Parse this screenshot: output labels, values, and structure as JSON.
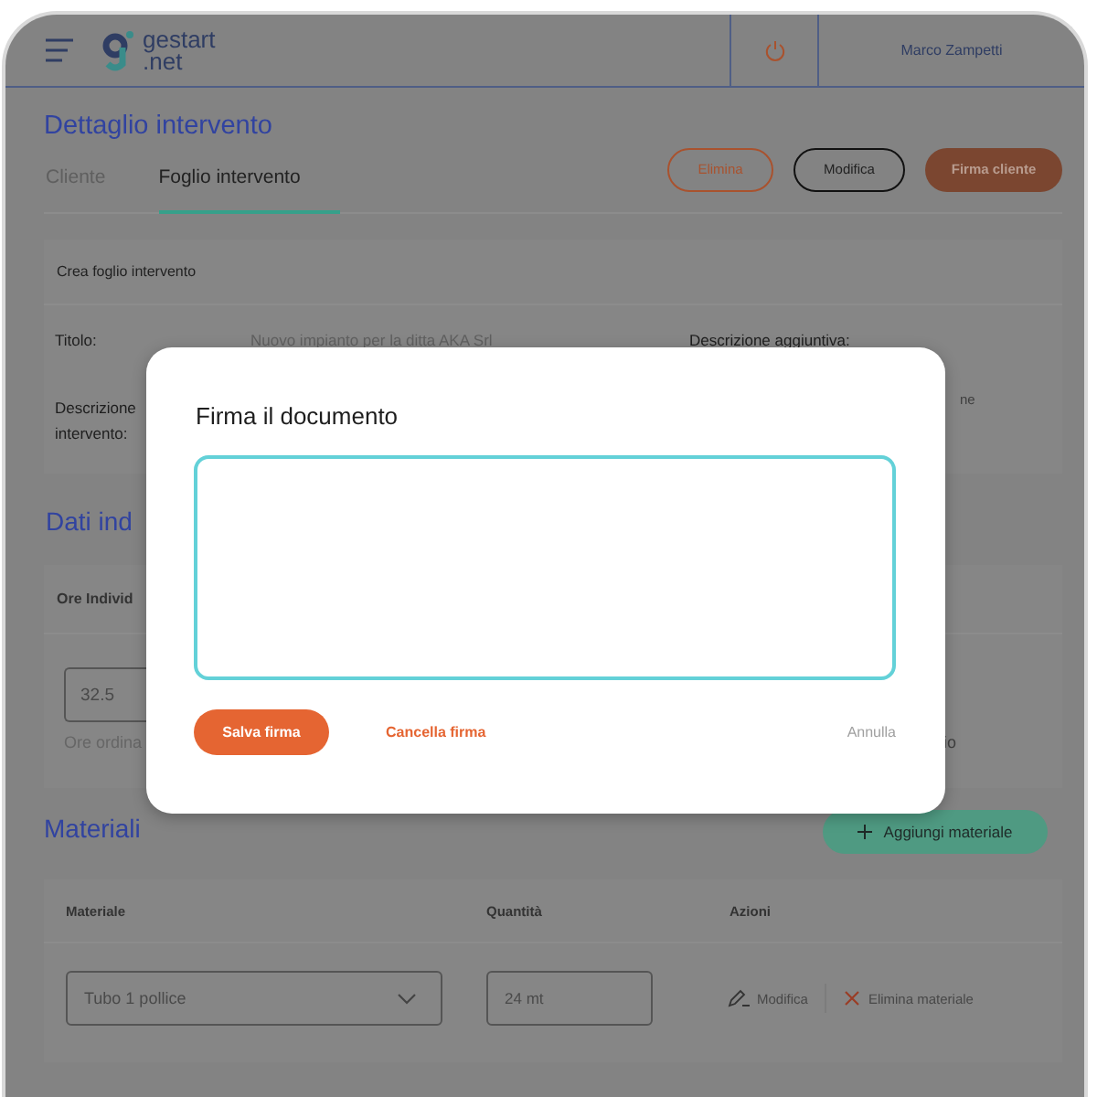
{
  "header": {
    "logo_line_1": "gestart",
    "logo_line_2": ".net",
    "user_name": "Marco Zampetti"
  },
  "page_title": "Dettaglio intervento",
  "tabs": [
    {
      "label": "Cliente",
      "selected": false
    },
    {
      "label": "Foglio intervento",
      "selected": true
    }
  ],
  "actions": [
    {
      "label": "Elimina",
      "kind": "outline-danger"
    },
    {
      "label": "Modifica",
      "kind": "outline"
    },
    {
      "label": "Firma cliente",
      "kind": "filled"
    }
  ],
  "form_card": {
    "heading": "Crea foglio intervento",
    "title_label": "Titolo:",
    "title_value": "Nuovo impianto per la ditta AKA Srl",
    "extra_label": "Descrizione aggiuntiva:",
    "description_label_line_1": "Descrizione",
    "description_label_line_2": "intervento:",
    "extra_value_tail": "ne"
  },
  "hours_section": {
    "heading": "Dati ind",
    "column_label": "Ore Individ",
    "hours_value": "32.5",
    "hint": "Ore ordina",
    "hint_tail": "io"
  },
  "materials": {
    "heading": "Materiali",
    "add_button": "Aggiungi materiale",
    "columns": [
      "Materiale",
      "Quantità",
      "Azioni"
    ],
    "rows": [
      {
        "material": "Tubo 1 pollice",
        "quantity": "24 mt",
        "edit": "Modifica",
        "delete": "Elimina materiale"
      }
    ]
  },
  "dialog": {
    "title": "Firma il documento",
    "save": "Salva firma",
    "clear": "Cancella firma",
    "cancel": "Annulla"
  }
}
